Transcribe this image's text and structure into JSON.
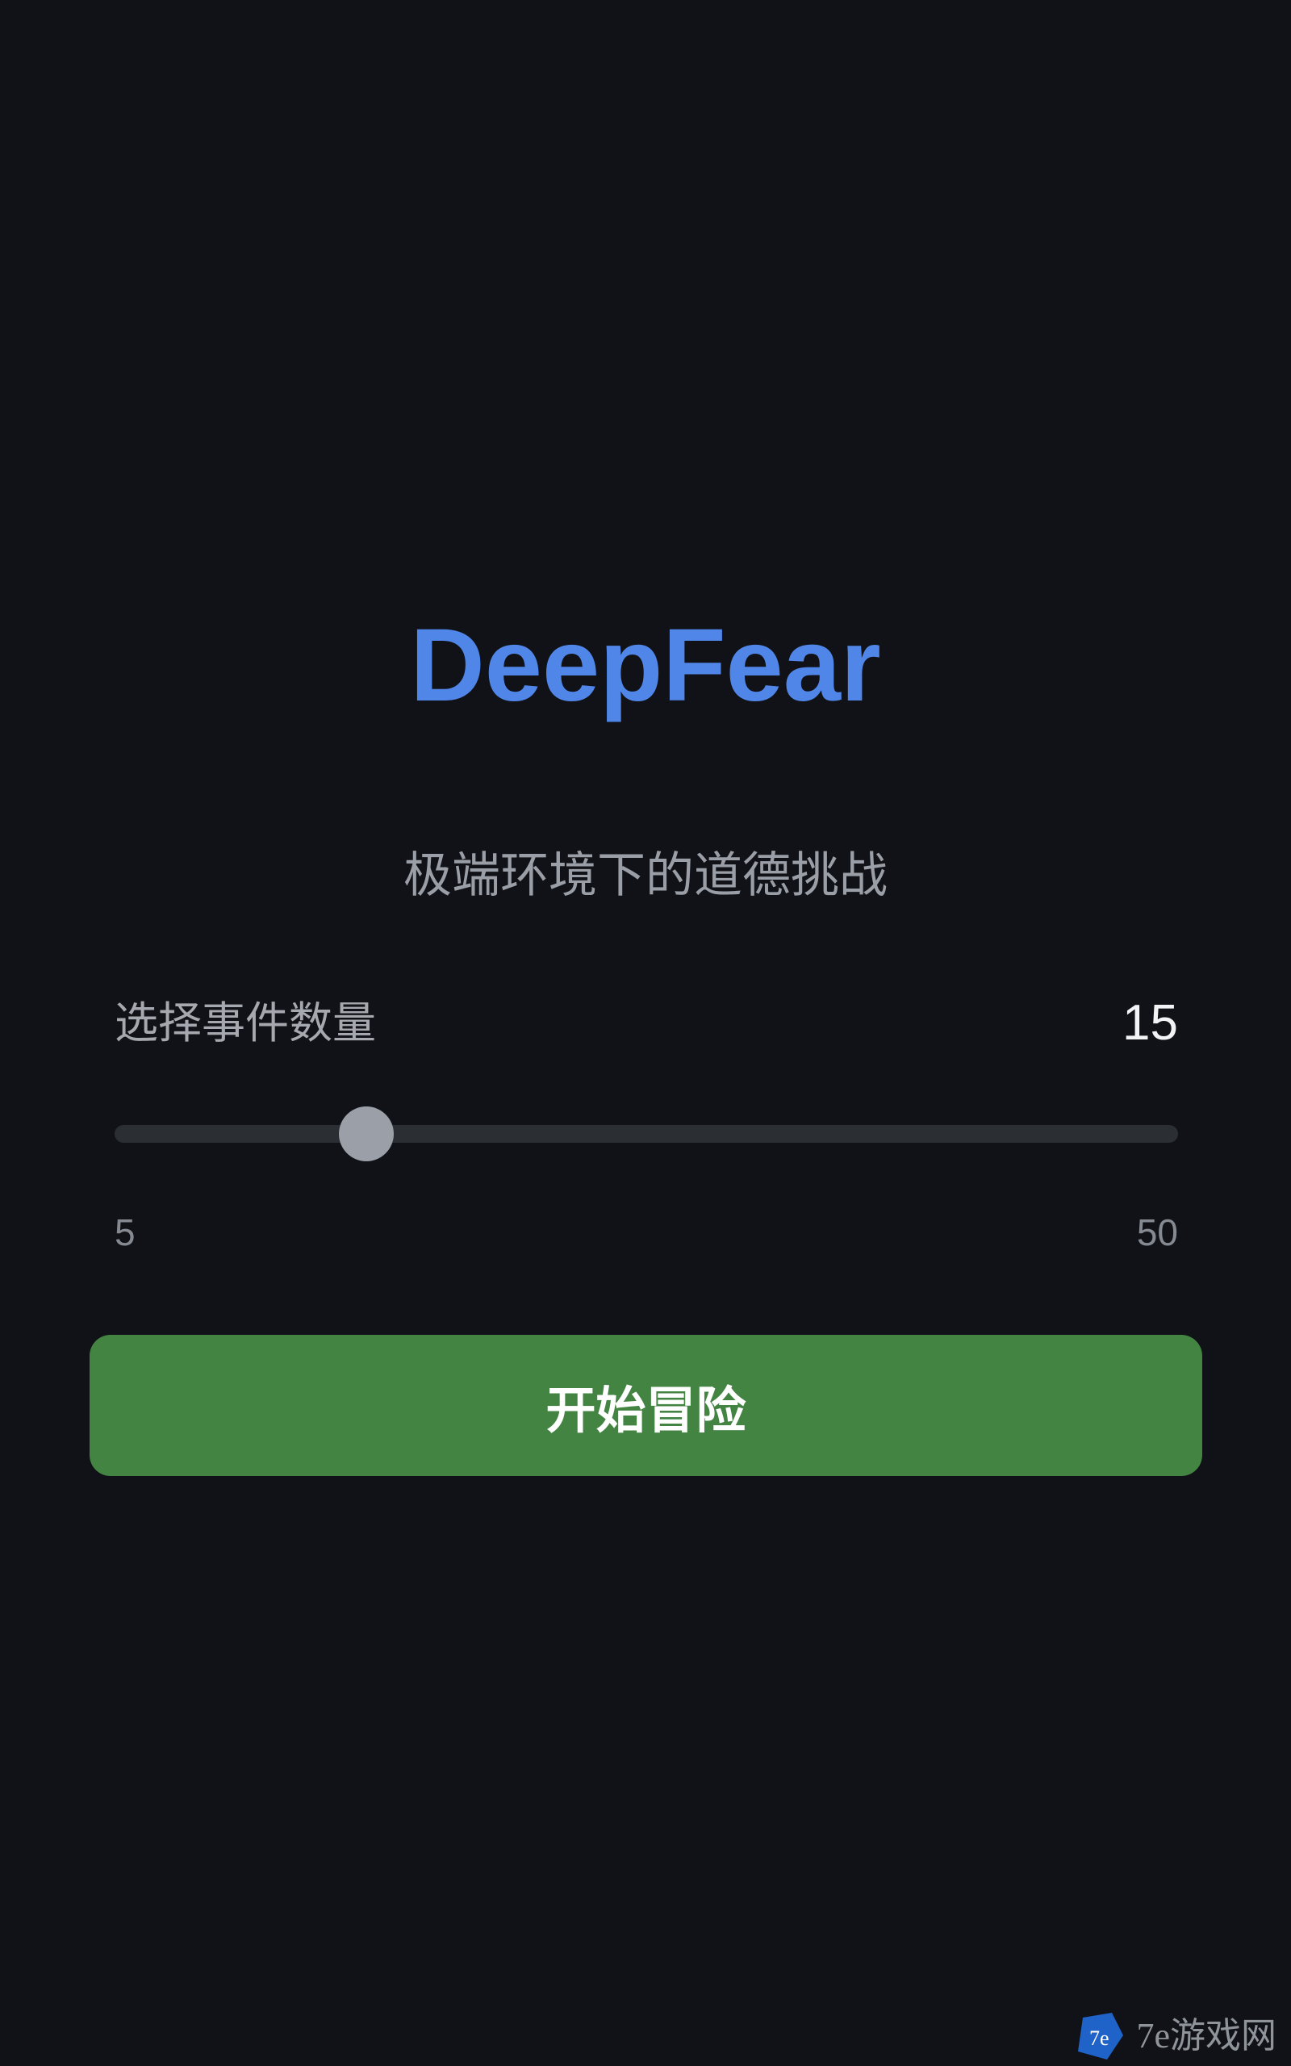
{
  "app": {
    "title": "DeepFear",
    "subtitle": "极端环境下的道德挑战"
  },
  "event_slider": {
    "label": "选择事件数量",
    "value": 15,
    "min": 5,
    "max": 50
  },
  "start_button": {
    "label": "开始冒险"
  },
  "watermark": {
    "text": "7e游戏网"
  },
  "colors": {
    "background": "#111217",
    "title": "#4f86e8",
    "button": "#438443",
    "track": "#2b2f34",
    "thumb": "#9a9fa8"
  }
}
